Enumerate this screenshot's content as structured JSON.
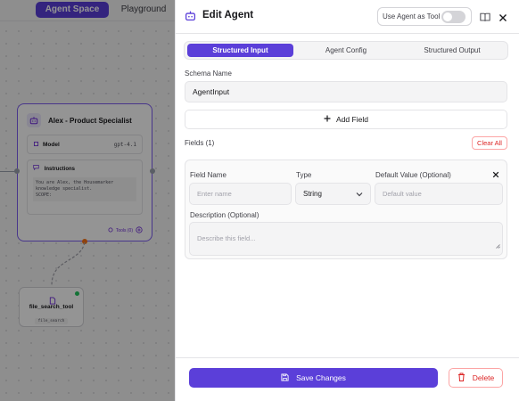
{
  "top_nav": {
    "tabs": [
      "Agent Space",
      "Playground"
    ]
  },
  "canvas": {
    "agent_node": {
      "title": "Alex - Product Specialist",
      "model_label": "Model",
      "model_value": "gpt-4.1",
      "instructions_label": "Instructions",
      "instructions_text": "You are Alex, the Housemarker\nknowledge specialist.\nSCOPE:",
      "tools_text": "Tools (0)"
    },
    "tool_node": {
      "title": "file_search_tool",
      "tag": "file_search"
    }
  },
  "panel": {
    "title": "Edit Agent",
    "use_as_tool_label": "Use Agent as Tool",
    "use_as_tool_enabled": false,
    "tabs": [
      "Structured Input",
      "Agent Config",
      "Structured Output"
    ],
    "active_tab": "Structured Input",
    "schema_name_label": "Schema Name",
    "schema_name_value": "AgentInput",
    "add_field_label": "Add Field",
    "fields_count_label": "Fields (1)",
    "clear_all_label": "Clear All",
    "field": {
      "name_label": "Field Name",
      "name_placeholder": "Enter name",
      "type_label": "Type",
      "type_value": "String",
      "default_label": "Default Value (Optional)",
      "default_placeholder": "Default value",
      "description_label": "Description (Optional)",
      "description_placeholder": "Describe this field..."
    },
    "save_label": "Save Changes",
    "delete_label": "Delete"
  },
  "colors": {
    "accent": "#5b3fd9",
    "danger": "#dc2626",
    "node_border": "#7c5cf0",
    "port_orange": "#f97316",
    "status_green": "#22c55e"
  }
}
